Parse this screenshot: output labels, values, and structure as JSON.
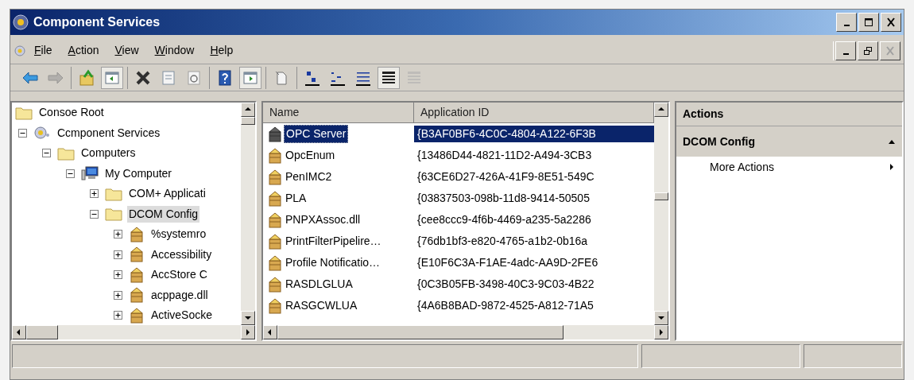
{
  "window": {
    "title": "Component Services"
  },
  "menu": [
    {
      "key": "F",
      "rest": "ile"
    },
    {
      "key": "A",
      "rest": "ction"
    },
    {
      "key": "V",
      "rest": "iew"
    },
    {
      "key": "W",
      "rest": "indow"
    },
    {
      "key": "H",
      "rest": "elp"
    }
  ],
  "toolbar": [
    [
      {
        "kind": "back",
        "disabled": false,
        "pressed": false
      },
      {
        "kind": "forward",
        "disabled": true,
        "pressed": false
      }
    ],
    [
      {
        "kind": "up",
        "disabled": false,
        "pressed": false
      },
      {
        "kind": "tree",
        "disabled": false,
        "pressed": true
      }
    ],
    [
      {
        "kind": "delete",
        "disabled": false,
        "pressed": false
      },
      {
        "kind": "properties",
        "disabled": false,
        "pressed": false
      },
      {
        "kind": "refresh",
        "disabled": false,
        "pressed": false
      }
    ],
    [
      {
        "kind": "help",
        "disabled": false,
        "pressed": false
      },
      {
        "kind": "action-pane",
        "disabled": false,
        "pressed": true
      }
    ],
    [
      {
        "kind": "export",
        "disabled": false,
        "pressed": false
      }
    ],
    [
      {
        "kind": "large-icons",
        "disabled": false,
        "pressed": false
      },
      {
        "kind": "small-icons",
        "disabled": false,
        "pressed": false
      },
      {
        "kind": "list",
        "disabled": false,
        "pressed": false
      },
      {
        "kind": "details",
        "disabled": false,
        "pressed": true
      },
      {
        "kind": "details-disabled",
        "disabled": true,
        "pressed": false
      }
    ]
  ],
  "tree": [
    {
      "label": "Consoe Root",
      "kind": "folder",
      "selected": false,
      "children": [
        {
          "label": "Ccmponent Services",
          "kind": "services",
          "expanded": true,
          "selected": false,
          "children": [
            {
              "label": "Computers",
              "kind": "folder",
              "expanded": true,
              "selected": false,
              "children": [
                {
                  "label": "My Computer",
                  "kind": "computer",
                  "expanded": true,
                  "selected": false,
                  "children": [
                    {
                      "label": "COM+ Applicati",
                      "kind": "folder",
                      "expanded": false,
                      "selected": false
                    },
                    {
                      "label": "DCOM Config",
                      "kind": "folder",
                      "expanded": true,
                      "selected": true,
                      "children": [
                        {
                          "label": "%systemro",
                          "kind": "package",
                          "expanded": false,
                          "selected": false
                        },
                        {
                          "label": "Accessibility",
                          "kind": "package",
                          "expanded": false,
                          "selected": false
                        },
                        {
                          "label": "AccStore C",
                          "kind": "package",
                          "expanded": false,
                          "selected": false
                        },
                        {
                          "label": "acppage.dll",
                          "kind": "package",
                          "expanded": false,
                          "selected": false
                        },
                        {
                          "label": "ActiveSocke",
                          "kind": "package",
                          "expanded": false,
                          "selected": false
                        }
                      ]
                    }
                  ]
                }
              ]
            }
          ]
        }
      ]
    }
  ],
  "list": {
    "columns": [
      "Name",
      "Application ID"
    ],
    "rows": [
      {
        "name": "OPC Server",
        "app_id": "{B3AF0BF6-4C0C-4804-A122-6F3B",
        "selected": true
      },
      {
        "name": "OpcEnum",
        "app_id": "{13486D44-4821-11D2-A494-3CB3",
        "selected": false
      },
      {
        "name": "PenIMC2",
        "app_id": "{63CE6D27-426A-41F9-8E51-549C",
        "selected": false
      },
      {
        "name": "PLA",
        "app_id": "{03837503-098b-11d8-9414-50505",
        "selected": false
      },
      {
        "name": "PNPXAssoc.dll",
        "app_id": "{cee8ccc9-4f6b-4469-a235-5a2286",
        "selected": false
      },
      {
        "name": "PrintFilterPipelire…",
        "app_id": "{76db1bf3-e820-4765-a1b2-0b16a",
        "selected": false
      },
      {
        "name": "Profile Notificatio…",
        "app_id": "{E10F6C3A-F1AE-4adc-AA9D-2FE6",
        "selected": false
      },
      {
        "name": "RASDLGLUA",
        "app_id": "{0C3B05FB-3498-40C3-9C03-4B22",
        "selected": false
      },
      {
        "name": "RASGCWLUA",
        "app_id": "{4A6B8BAD-9872-4525-A812-71A5",
        "selected": false
      }
    ]
  },
  "actions": {
    "title": "Actions",
    "sections": [
      {
        "title": "DCOM Config",
        "expanded": true,
        "items": [
          {
            "label": "More Actions",
            "submenu": true
          }
        ]
      }
    ]
  }
}
